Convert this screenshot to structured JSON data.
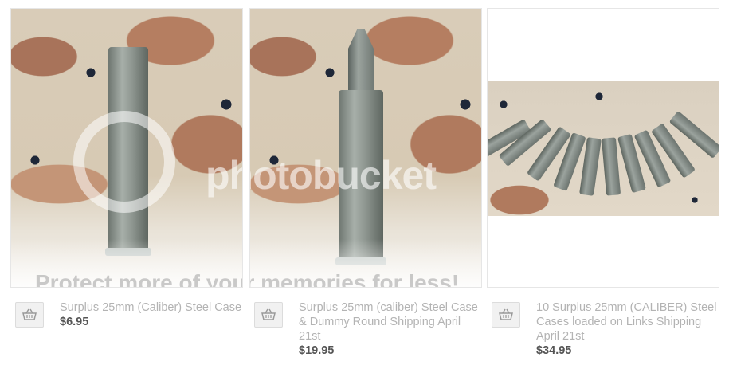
{
  "watermark": {
    "brand": "photobucket",
    "tagline": "Protect more of your memories for less!"
  },
  "products": [
    {
      "title": "Surplus 25mm (Caliber) Steel Case",
      "price": "$6.95",
      "cart_icon": "basket-icon"
    },
    {
      "title": "Surplus 25mm (caliber) Steel Case & Dummy Round Shipping April 21st",
      "price": "$19.95",
      "cart_icon": "basket-icon"
    },
    {
      "title": "10 Surplus 25mm (CALIBER) Steel Cases loaded on Links Shipping April 21st",
      "price": "$34.95",
      "cart_icon": "basket-icon"
    }
  ],
  "colors": {
    "title_text": "#b3b3b3",
    "price_text": "#555555"
  }
}
